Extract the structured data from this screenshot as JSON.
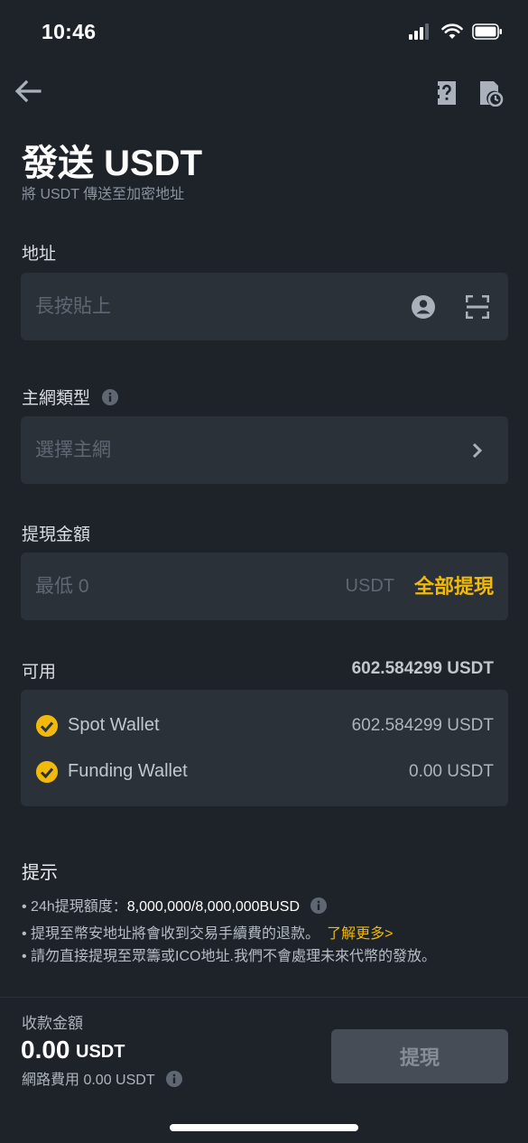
{
  "status_bar": {
    "time": "10:46"
  },
  "header": {
    "back_icon": "arrow-left-icon",
    "faq_icon": "question-document-icon",
    "history_icon": "history-document-icon"
  },
  "page": {
    "title": "發送 USDT",
    "subtitle": "將 USDT 傳送至加密地址"
  },
  "address": {
    "label": "地址",
    "placeholder": "長按貼上",
    "contact_icon": "contact-icon",
    "scan_icon": "scan-icon"
  },
  "network": {
    "label": "主網類型",
    "placeholder": "選擇主網"
  },
  "amount": {
    "label": "提現金額",
    "placeholder": "最低 0",
    "unit": "USDT",
    "max_label": "全部提現"
  },
  "available": {
    "label": "可用",
    "total": "602.584299 USDT",
    "wallets": [
      {
        "name": "Spot Wallet",
        "amount": "602.584299 USDT"
      },
      {
        "name": "Funding Wallet",
        "amount": "0.00 USDT"
      }
    ]
  },
  "tips": {
    "title": "提示",
    "line1_prefix": "• 24h提現額度：",
    "line1_value": "8,000,000/8,000,000BUSD",
    "line2_text": "• 提現至幣安地址將會收到交易手續費的退款。",
    "line2_link": "了解更多>",
    "line3_text": "• 請勿直接提現至眾籌或ICO地址.我們不會處理未來代幣的發放。"
  },
  "footer": {
    "receive_label": "收款金額",
    "receive_amount": "0.00",
    "receive_unit": "USDT",
    "fee_text": "網路費用 0.00 USDT",
    "submit_label": "提現"
  },
  "colors": {
    "background": "#1e2329",
    "field": "#2b3139",
    "accent": "#f0b90b",
    "button_disabled": "#474d57"
  }
}
